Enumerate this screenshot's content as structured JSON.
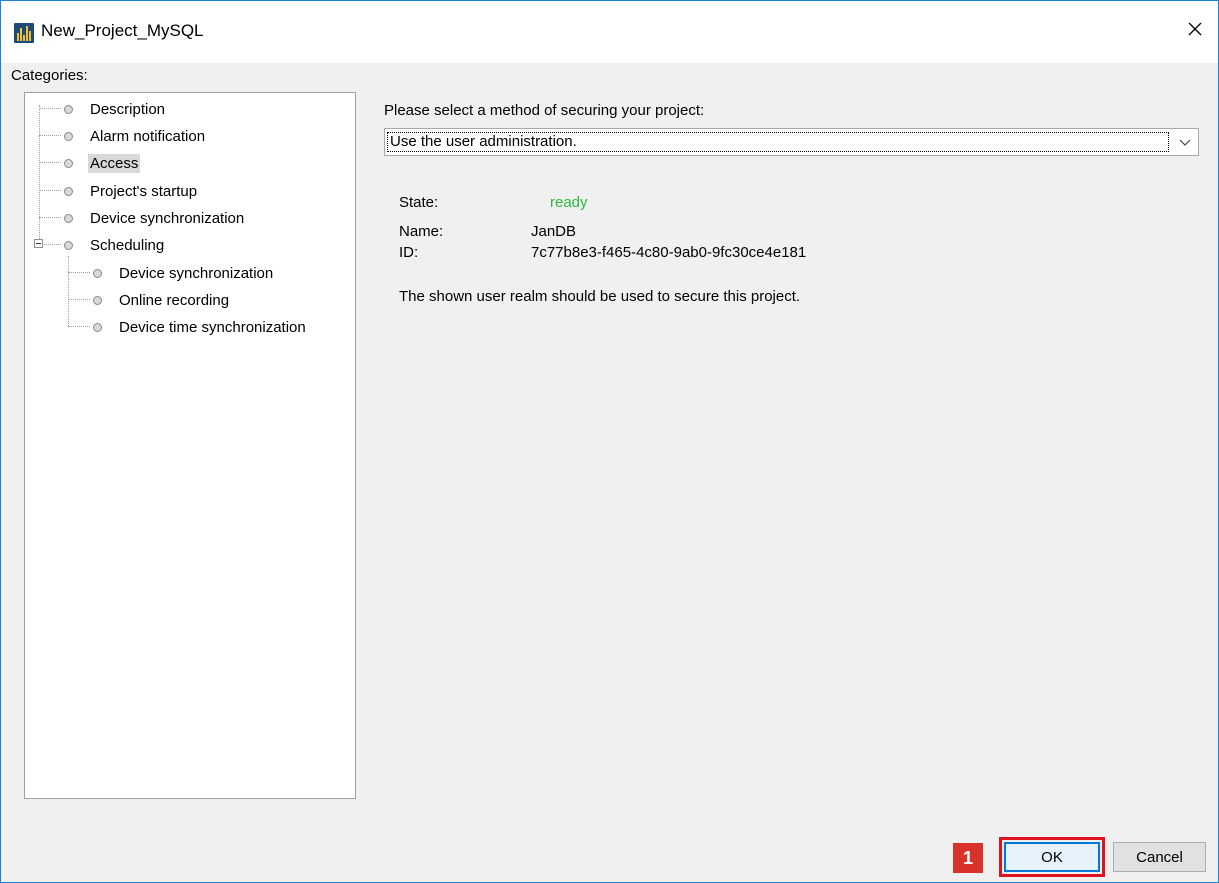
{
  "window": {
    "title": "New_Project_MySQL",
    "close_glyph": "✕"
  },
  "categories": {
    "label": "Categories:",
    "items": [
      {
        "label": "Description",
        "level": 0
      },
      {
        "label": "Alarm notification",
        "level": 0
      },
      {
        "label": "Access",
        "level": 0,
        "selected": true
      },
      {
        "label": "Project's startup",
        "level": 0
      },
      {
        "label": "Device synchronization",
        "level": 0
      },
      {
        "label": "Scheduling",
        "level": 0,
        "expanded": true
      },
      {
        "label": "Device synchronization",
        "level": 1
      },
      {
        "label": "Online recording",
        "level": 1
      },
      {
        "label": "Device time synchronization",
        "level": 1
      }
    ]
  },
  "security": {
    "prompt": "Please select a method of securing your project:",
    "method_selected": "Use the user administration.",
    "state_label": "State:",
    "state_value": "ready",
    "name_label": "Name:",
    "name_value": "JanDB",
    "id_label": "ID:",
    "id_value": "7c77b8e3-f465-4c80-9ab0-9fc30ce4e181",
    "note": "The shown user realm should be used to secure this project."
  },
  "footer": {
    "badge": "1",
    "ok_label": "OK",
    "cancel_label": "Cancel"
  },
  "colors": {
    "ready": "#2dbb3b",
    "highlight": "#e0121f",
    "badge": "#d9322a",
    "window_border": "#1883d7"
  }
}
